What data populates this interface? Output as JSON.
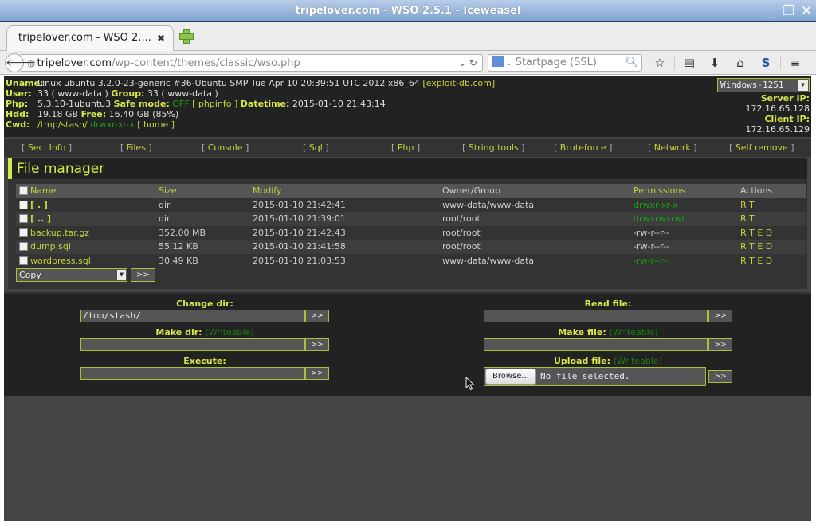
{
  "window": {
    "title": "tripelover.com - WSO 2.5.1 - Iceweasel",
    "controls": [
      "minimize",
      "maximize",
      "close"
    ]
  },
  "browser": {
    "tab_label": "tripelover.com - WSO 2....",
    "tab_close": "✖",
    "url_host": "tripelover.com",
    "url_path": "/wp-content/themes/classic/wso.php",
    "search_placeholder": "Startpage (SSL)",
    "toolbar_icons": [
      "bookmark-star-icon",
      "reading-list-icon",
      "download-icon",
      "home-icon",
      "s-addon-icon",
      "menu-icon"
    ]
  },
  "header": {
    "uname_label": "Uname:",
    "uname_value": "Linux ubuntu 3.2.0-23-generic #36-Ubuntu SMP Tue Apr 10 20:39:51 UTC 2012 x86_64",
    "uname_link": "[exploit-db.com]",
    "user_label": "User:",
    "user_value": "33 ( www-data )",
    "group_label": "Group:",
    "group_value": "33 ( www-data )",
    "php_label": "Php:",
    "php_value": "5.3.10-1ubuntu3",
    "safe_mode_label": "Safe mode:",
    "safe_mode_value": "OFF",
    "phpinfo_link": "[ phpinfo ]",
    "datetime_label": "Datetime:",
    "datetime_value": "2015-01-10 21:43:14",
    "hdd_label": "Hdd:",
    "hdd_value": "19.18 GB",
    "free_label": "Free:",
    "free_value": "16.40 GB (85%)",
    "cwd_label": "Cwd:",
    "cwd_value": "/tmp/stash/",
    "cwd_perms": "drwxr-xr-x",
    "home_link": "[ home ]",
    "charset": "Windows-1251",
    "server_ip_label": "Server IP:",
    "server_ip": "172.16.65.128",
    "client_ip_label": "Client IP:",
    "client_ip": "172.16.65.129"
  },
  "menu": [
    {
      "label": "Sec. Info"
    },
    {
      "label": "Files"
    },
    {
      "label": "Console"
    },
    {
      "label": "Sql"
    },
    {
      "label": "Php"
    },
    {
      "label": "String tools"
    },
    {
      "label": "Bruteforce"
    },
    {
      "label": "Network"
    },
    {
      "label": "Self remove"
    }
  ],
  "file_manager": {
    "title": "File manager",
    "columns": {
      "name": "Name",
      "size": "Size",
      "modify": "Modify",
      "owner": "Owner/Group",
      "permissions": "Permissions",
      "actions": "Actions"
    },
    "rows": [
      {
        "name": "[ . ]",
        "size": "dir",
        "modify": "2015-01-10 21:42:41",
        "owner": "www-data/www-data",
        "perms": "drwxr-xr-x",
        "actions": "R T"
      },
      {
        "name": "[ .. ]",
        "size": "dir",
        "modify": "2015-01-10 21:39:01",
        "owner": "root/root",
        "perms": "drwxrwxrwt",
        "actions": "R T"
      },
      {
        "name": "backup.tar.gz",
        "size": "352.00 MB",
        "modify": "2015-01-10 21:42:43",
        "owner": "root/root",
        "perms": "-rw-r--r--",
        "actions": "R T E D"
      },
      {
        "name": "dump.sql",
        "size": "55.12 KB",
        "modify": "2015-01-10 21:41:58",
        "owner": "root/root",
        "perms": "-rw-r--r--",
        "actions": "R T E D"
      },
      {
        "name": "wordpress.sql",
        "size": "30.49 KB",
        "modify": "2015-01-10 21:03:53",
        "owner": "www-data/www-data",
        "perms": "-rw-r--r--",
        "actions": "R T E D"
      }
    ],
    "bulk_action": "Copy",
    "go_label": ">>"
  },
  "tools": {
    "change_dir_label": "Change dir:",
    "change_dir_value": "/tmp/stash/",
    "make_dir_label": "Make dir:",
    "writeable": "(Writeable)",
    "execute_label": "Execute:",
    "read_file_label": "Read file:",
    "make_file_label": "Make file:",
    "upload_file_label": "Upload file:",
    "browse_label": "Browse...",
    "no_file": "No file selected.",
    "go_label": ">>"
  },
  "colors": {
    "accent": "#d6e84a",
    "link": "#c4d33a",
    "ok_green": "#1aa00f",
    "bg_dark": "#222222",
    "bg_panel": "#333333",
    "bg_page": "#444444"
  }
}
